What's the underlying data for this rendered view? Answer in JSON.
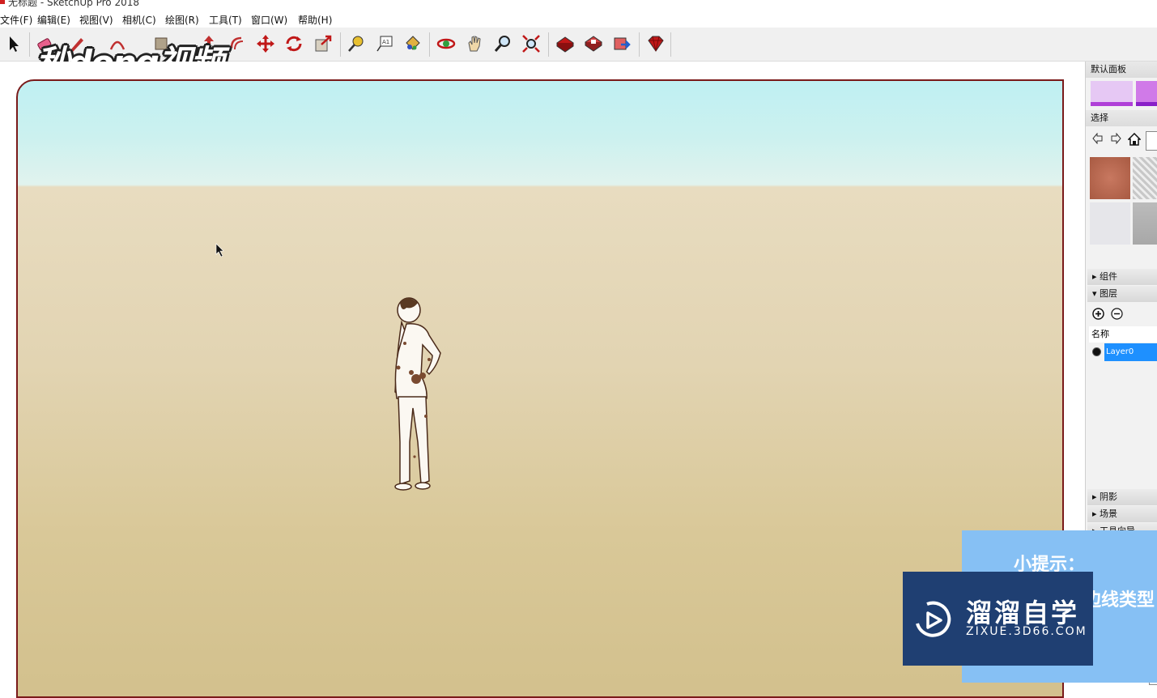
{
  "window": {
    "title": "无标题 - SketchUp Pro 2018"
  },
  "menu": [
    "文件(F)",
    "编辑(E)",
    "视图(V)",
    "相机(C)",
    "绘图(R)",
    "工具(T)",
    "窗口(W)",
    "帮助(H)"
  ],
  "toolbar": {
    "icons": [
      "select-arrow-icon",
      "eraser-icon",
      "pencil-icon",
      "arc-icon",
      "rectangle-icon",
      "push-pull-icon",
      "offset-icon",
      "move-icon",
      "rotate-icon",
      "scale-icon",
      "tape-measure-icon",
      "text-icon",
      "paint-bucket-icon",
      "orbit-icon",
      "pan-icon",
      "zoom-icon",
      "zoom-extents-icon",
      "warehouse-icon",
      "extension-warehouse-icon",
      "layout-icon",
      "ruby-icon"
    ]
  },
  "watermark": {
    "text": "秒dong视频"
  },
  "panel": {
    "header": "默认面板",
    "materials_title": "选择",
    "collapsed_components": "组件",
    "expanded_layers": "图层",
    "layers_name_header": "名称",
    "layer_name": "Layer0",
    "collapsed_shadows": "阴影",
    "collapsed_scenes": "场景",
    "collapsed_tools": "工具向导"
  },
  "colors": {
    "accent": "#1e90ff",
    "sky_top": "#bff0f3",
    "ground": "#d9c898",
    "viewport_border": "#7a1a1a",
    "tip_bg": "#86c0f4",
    "brand_bg": "#1f3f72"
  },
  "overlay_tip": {
    "title": "小提示：",
    "text": "边线类型"
  },
  "brand": {
    "name": "溜溜自学",
    "url": "ZIXUE.3D66.COM"
  }
}
